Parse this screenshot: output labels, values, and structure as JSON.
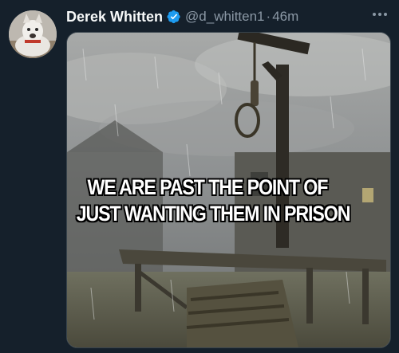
{
  "tweet": {
    "display_name": "Derek Whitten",
    "verified": true,
    "handle": "@d_whitten1",
    "separator": "·",
    "time": "46m"
  },
  "media": {
    "caption_line1": "WE ARE PAST THE POINT OF",
    "caption_line2": "JUST WANTING THEM IN PRISON"
  },
  "colors": {
    "background": "#15202b",
    "text_primary": "#f7f9f9",
    "text_secondary": "#8b98a5",
    "verified_badge": "#1d9bf0"
  },
  "icons": {
    "verified": "verified-badge-icon",
    "more": "more-options-icon"
  }
}
